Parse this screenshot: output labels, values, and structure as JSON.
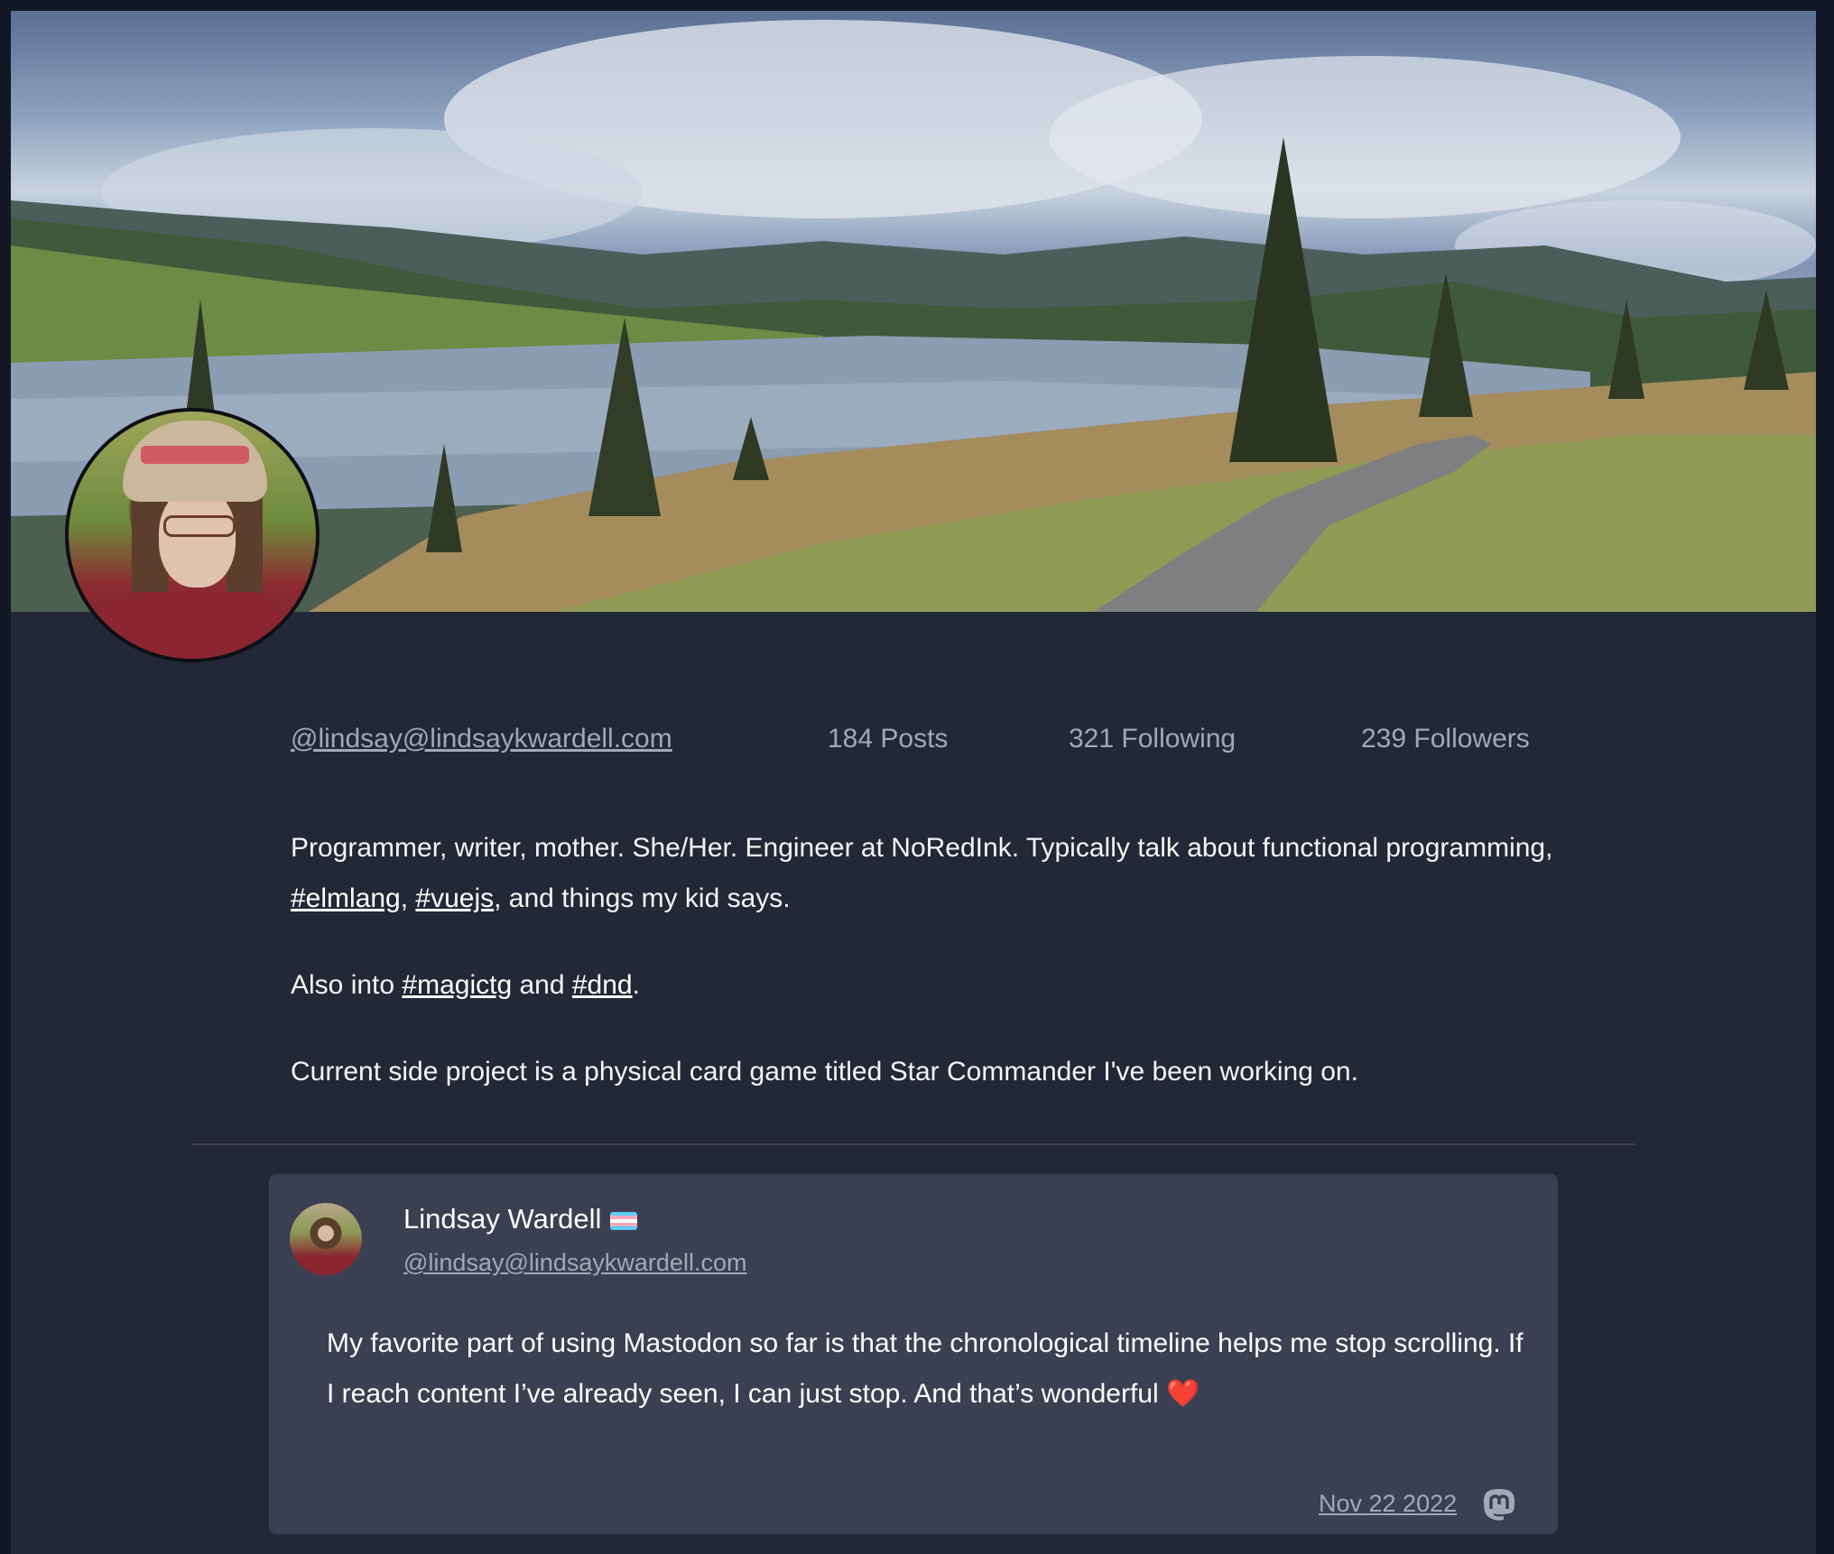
{
  "profile": {
    "handle": "@lindsay@lindsaykwardell.com",
    "posts": "184 Posts",
    "following": "321 Following",
    "followers": "239 Followers",
    "bio": {
      "p1_a": "Programmer, writer, mother. She/Her. Engineer at NoRedInk. Typically talk about functional programming, ",
      "tag_elmlang": "#elmlang",
      "p1_sep": ", ",
      "tag_vuejs": "#vuejs",
      "p1_b": ", and things my kid says.",
      "p2_a": "Also into ",
      "tag_magictg": "#magictg",
      "p2_sep": " and ",
      "tag_dnd": "#dnd",
      "p2_b": ".",
      "p3": "Current side project is a physical card game titled Star Commander I've been working on."
    }
  },
  "post": {
    "author_name": "Lindsay Wardell",
    "author_flag": "transgender-flag-emoji",
    "author_handle": "@lindsay@lindsaykwardell.com",
    "content": "My favorite part of using Mastodon so far is that the chronological timeline helps me stop scrolling. If I reach content I’ve already seen, I can just stop. And that’s wonderful ❤️",
    "date": "Nov 22 2022",
    "source_icon": "mastodon-icon"
  },
  "colors": {
    "background": "#222836",
    "card": "#3a4051",
    "muted_text": "#a2a8b6",
    "text": "#ffffff"
  }
}
